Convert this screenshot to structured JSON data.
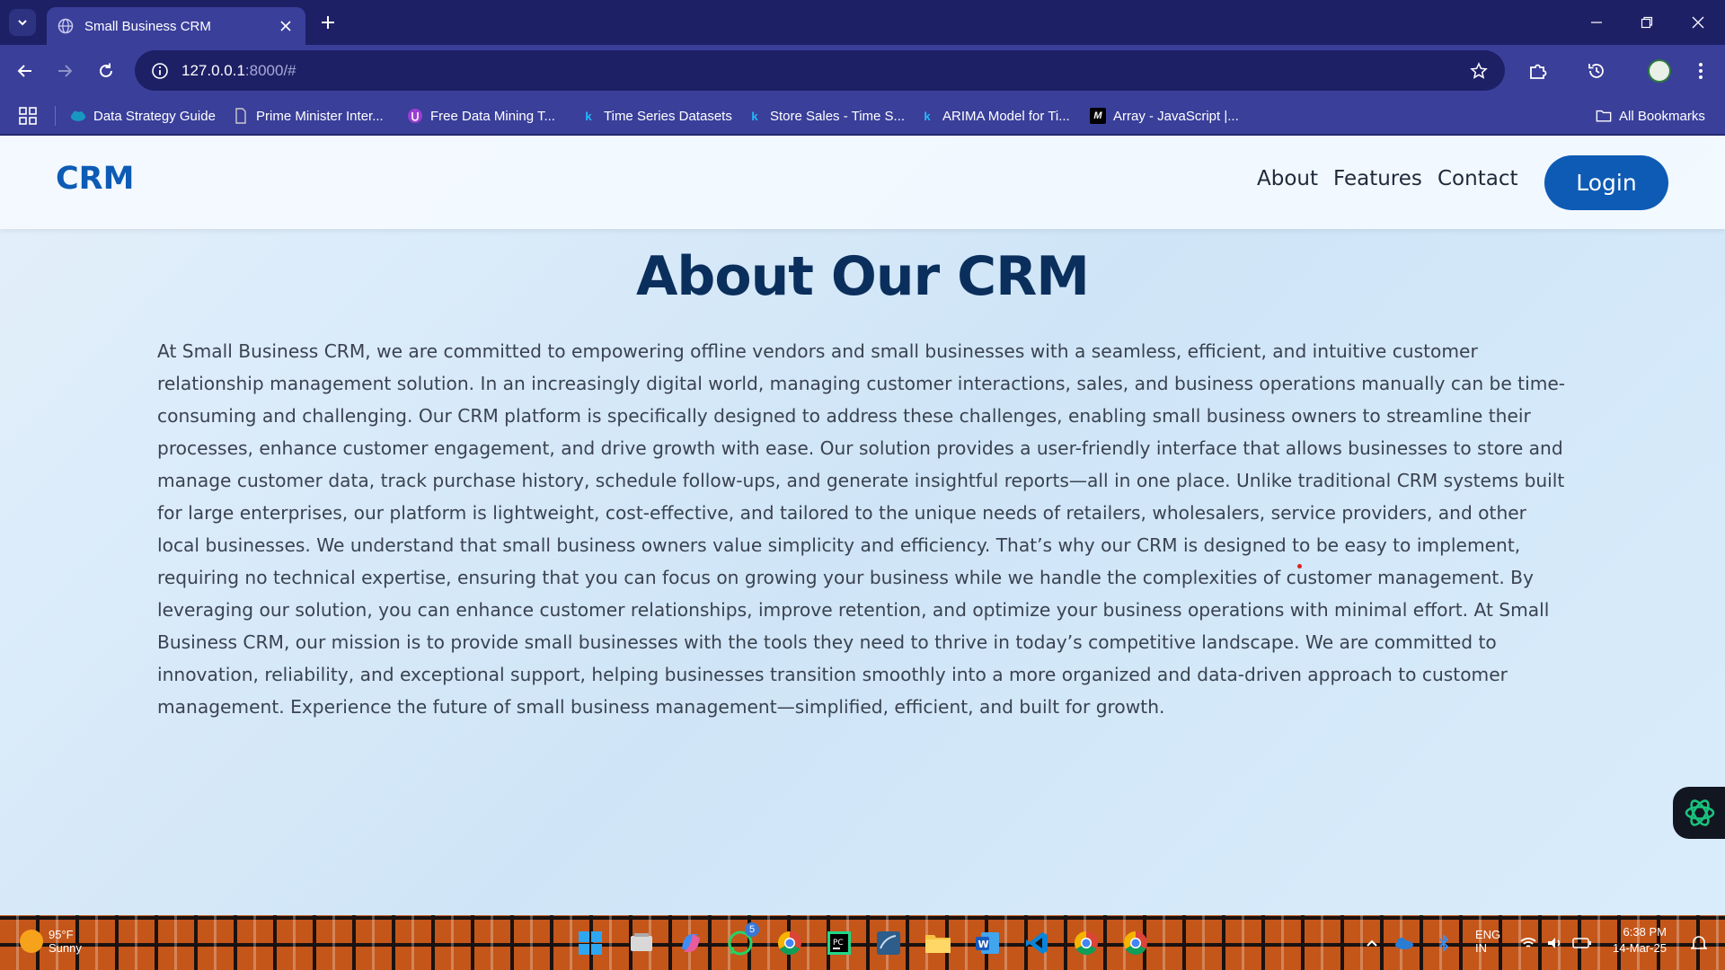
{
  "browser": {
    "tab": {
      "title": "Small Business CRM"
    },
    "url": {
      "host": "127.0.0.1",
      "rest": ":8000/#"
    },
    "bookmarks": [
      {
        "label": "Data Strategy Guide",
        "icon": "salesforce-cloud-icon",
        "color": "#1798c1"
      },
      {
        "label": "Prime Minister Inter...",
        "icon": "document-icon",
        "color": "#cccccc"
      },
      {
        "label": "Free Data Mining T...",
        "icon": "shield-icon",
        "color": "#9b3fd1"
      },
      {
        "label": "Time Series Datasets",
        "icon": "kaggle-icon",
        "color": "#20beff"
      },
      {
        "label": "Store Sales - Time S...",
        "icon": "kaggle-icon",
        "color": "#20beff"
      },
      {
        "label": "ARIMA Model for Ti...",
        "icon": "kaggle-icon",
        "color": "#20beff"
      },
      {
        "label": "Array - JavaScript |...",
        "icon": "mdn-icon",
        "color": "#ffffff"
      }
    ],
    "all_bookmarks": "All Bookmarks"
  },
  "site": {
    "brand": "CRM",
    "nav": {
      "about": "About",
      "features": "Features",
      "contact": "Contact"
    },
    "login": "Login",
    "brand_color": "#0d5bb5"
  },
  "about": {
    "title": "About Our CRM",
    "body": "At Small Business CRM, we are committed to empowering offline vendors and small businesses with a seamless, efficient, and intuitive customer relationship management solution. In an increasingly digital world, managing customer interactions, sales, and business operations manually can be time-consuming and challenging. Our CRM platform is specifically designed to address these challenges, enabling small business owners to streamline their processes, enhance customer engagement, and drive growth with ease. Our solution provides a user-friendly interface that allows businesses to store and manage customer data, track purchase history, schedule follow-ups, and generate insightful reports—all in one place. Unlike traditional CRM systems built for large enterprises, our platform is lightweight, cost-effective, and tailored to the unique needs of retailers, wholesalers, service providers, and other local businesses. We understand that small business owners value simplicity and efficiency. That’s why our CRM is designed to be easy to implement, requiring no technical expertise, ensuring that you can focus on growing your business while we handle the complexities of customer management. By leveraging our solution, you can enhance customer relationships, improve retention, and optimize your business operations with minimal effort. At Small Business CRM, our mission is to provide small businesses with the tools they need to thrive in today’s competitive landscape. We are committed to innovation, reliability, and exceptional support, helping businesses transition smoothly into a more organized and data-driven approach to customer management. Experience the future of small business management—simplified, efficient, and built for growth."
  },
  "taskbar": {
    "weather": {
      "temp": "95°F",
      "condition": "Sunny"
    },
    "whatsapp_badge": "5",
    "lang": "ENG",
    "lang_sub": "IN",
    "time": "6:38 PM",
    "date": "14-Mar-25"
  }
}
